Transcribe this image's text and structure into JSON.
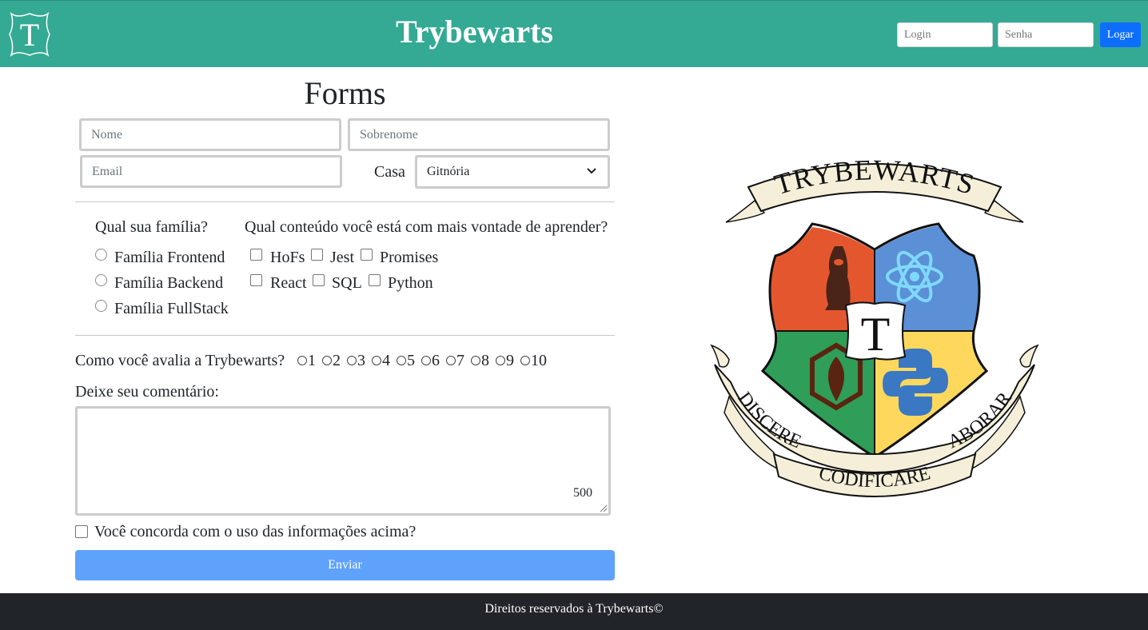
{
  "header": {
    "logo_letter": "T",
    "brand": "Trybewarts",
    "login_placeholder": "Login",
    "password_placeholder": "Senha",
    "login_button": "Logar"
  },
  "form": {
    "title": "Forms",
    "name_placeholder": "Nome",
    "lastname_placeholder": "Sobrenome",
    "email_placeholder": "Email",
    "house_label": "Casa",
    "house_selected": "Gitnória",
    "family_question": "Qual sua família?",
    "families": [
      "Família Frontend",
      "Família Backend",
      "Família FullStack"
    ],
    "content_question": "Qual conteúdo você está com mais vontade de aprender?",
    "contents": [
      "HoFs",
      "Jest",
      "Promises",
      "React",
      "SQL",
      "Python"
    ],
    "rating_question": "Como você avalia a Trybewarts?",
    "ratings": [
      "1",
      "2",
      "3",
      "4",
      "5",
      "6",
      "7",
      "8",
      "9",
      "10"
    ],
    "comment_label": "Deixe seu comentário:",
    "counter": "500",
    "agree_label": "Você concorda com o uso das informações acima?",
    "submit": "Enviar"
  },
  "crest": {
    "banner_top": "TRYBEWARTS",
    "center_letter": "T",
    "motto_left": "DISCERE",
    "motto_center": "CODIFICARE",
    "motto_right": "LABORARE",
    "colors": {
      "red": "#e4572e",
      "blue": "#5b8fd6",
      "green": "#2e9e58",
      "yellow": "#fed85d",
      "parchment": "#f5efd9"
    }
  },
  "footer": {
    "text": "Direitos reservados à Trybewarts©"
  },
  "colors": {
    "header_bg": "#34a993",
    "primary": "#0d6efd",
    "submit_bg": "#5ea2fc",
    "footer_bg": "#212529"
  }
}
